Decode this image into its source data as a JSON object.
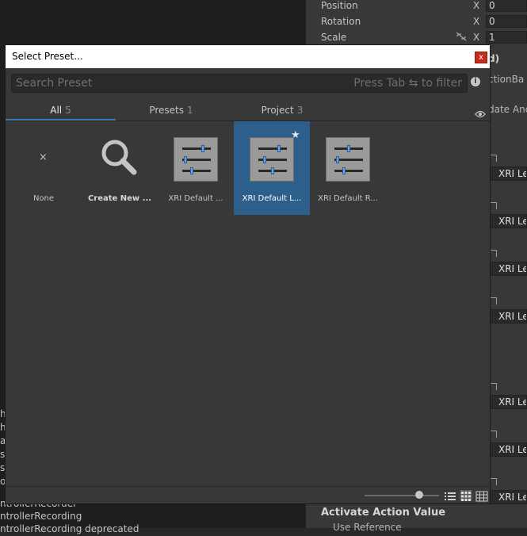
{
  "dialog": {
    "title": "Select Preset...",
    "close_label": "x",
    "search_placeholder": "Search Preset",
    "search_hint": "Press Tab ⇆ to filter",
    "help_label": "i"
  },
  "tabs": [
    {
      "label": "All",
      "count": "5"
    },
    {
      "label": "Presets",
      "count": "1"
    },
    {
      "label": "Project",
      "count": "3"
    }
  ],
  "items": [
    {
      "label": "None",
      "icon": "close-icon"
    },
    {
      "label": "Create New ...",
      "icon": "search-icon"
    },
    {
      "label": "XRI Default ...",
      "icon": "preset-icon"
    },
    {
      "label": "XRI Default L...",
      "icon": "preset-icon",
      "selected": true,
      "favorite": true
    },
    {
      "label": "XRI Default R...",
      "icon": "preset-icon"
    }
  ],
  "footer": {
    "zoom_level": 0.75,
    "views": [
      "list-view-icon",
      "grid-view-icon",
      "table-view-icon"
    ]
  },
  "background": {
    "transform": [
      {
        "label": "Position",
        "axis": "X",
        "value": "0"
      },
      {
        "label": "Rotation",
        "axis": "X",
        "value": "0"
      },
      {
        "label": "Scale",
        "axis": "X",
        "value": "1"
      }
    ],
    "fragments": {
      "header_frag": "d)",
      "action_frag": "ctionBa",
      "update_frag": "date And",
      "ref_label": "XRI Le"
    },
    "bottom_title": "Activate Action Value",
    "bottom_sub": "Use Reference",
    "left_list": [
      "ntrollerRecorder",
      "ntrollerRecording",
      "ntrollerRecording deprecated"
    ],
    "left_letters": [
      "h",
      "h",
      "a",
      "s",
      "s",
      "o"
    ]
  }
}
